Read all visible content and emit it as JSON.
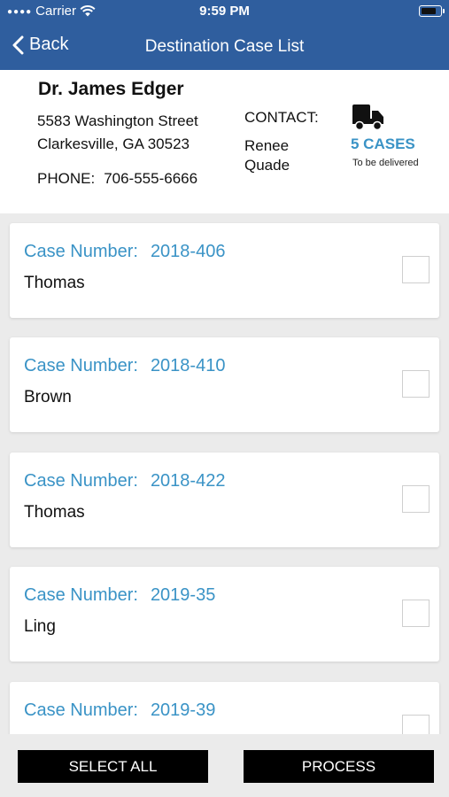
{
  "status_bar": {
    "carrier": "Carrier",
    "time": "9:59 PM"
  },
  "nav": {
    "back_label": "Back",
    "title": "Destination Case List"
  },
  "destination": {
    "name": "Dr. James Edger",
    "address_line1": "5583 Washington Street",
    "address_line2": "Clarkesville, GA 30523",
    "phone_label": "PHONE:",
    "phone": "706-555-6666",
    "contact_label": "CONTACT:",
    "contact_name": "Renee Quade",
    "cases_count": "5 CASES",
    "cases_sub": "To be delivered"
  },
  "case_label": "Case Number:",
  "cases": [
    {
      "number": "2018-406",
      "name": "Thomas",
      "checked": false
    },
    {
      "number": "2018-410",
      "name": "Brown",
      "checked": false
    },
    {
      "number": "2018-422",
      "name": "Thomas",
      "checked": false
    },
    {
      "number": "2019-35",
      "name": "Ling",
      "checked": false
    },
    {
      "number": "2019-39",
      "name": "",
      "checked": false
    }
  ],
  "actions": {
    "select_all": "SELECT ALL",
    "process": "PROCESS"
  },
  "colors": {
    "nav_bg": "#2f5e9e",
    "accent": "#3a93c6",
    "button_bg": "#000000"
  },
  "icons": {
    "back": "chevron-left-icon",
    "wifi": "wifi-icon",
    "battery": "battery-icon",
    "truck": "truck-icon"
  }
}
